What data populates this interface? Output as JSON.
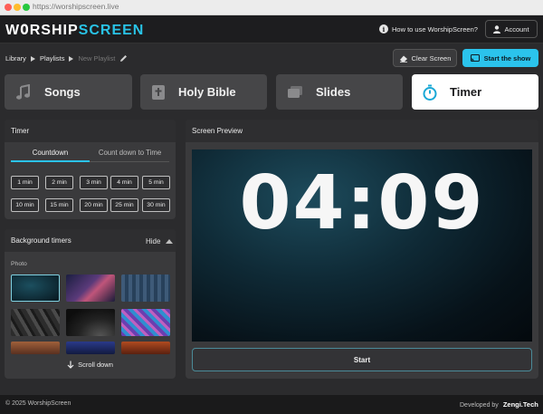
{
  "browser": {
    "url": "https://worshipscreen.live"
  },
  "header": {
    "logo_part1": "W",
    "logo_o": "O",
    "logo_part2": "RSHIP",
    "logo_part3": "SCREEN",
    "howto_label": "How to use WorshipScreen?",
    "account_label": "Account"
  },
  "breadcrumb": {
    "library": "Library",
    "playlists": "Playlists",
    "current": "New Playlist"
  },
  "toolbar": {
    "clear_label": "Clear Screen",
    "start_show_label": "Start the show"
  },
  "tabs": [
    {
      "label": "Songs",
      "icon": "music-note-icon"
    },
    {
      "label": "Holy Bible",
      "icon": "bible-icon"
    },
    {
      "label": "Slides",
      "icon": "slides-icon"
    },
    {
      "label": "Timer",
      "icon": "stopwatch-icon",
      "active": true
    }
  ],
  "timer": {
    "title": "Timer",
    "mode_tabs": [
      "Countdown",
      "Count down to Time"
    ],
    "active_mode": "Countdown",
    "presets": [
      "1 min",
      "2 min",
      "3 min",
      "4 min",
      "5 min",
      "10 min",
      "15 min",
      "20 min",
      "25 min",
      "30 min"
    ]
  },
  "background": {
    "title": "Background timers",
    "hide_label": "Hide",
    "section_label": "Photo",
    "scroll_label": "Scroll down"
  },
  "preview": {
    "title": "Screen Preview",
    "clock": "04:09",
    "start_label": "Start"
  },
  "footer": {
    "copyright": "© 2025 WorshipScreen",
    "developed_by": "Developed by",
    "developer": "Zengi.Tech"
  },
  "colors": {
    "accent": "#2bc3ec",
    "background": "#2b2b2d",
    "panel": "#3a3a3c"
  }
}
